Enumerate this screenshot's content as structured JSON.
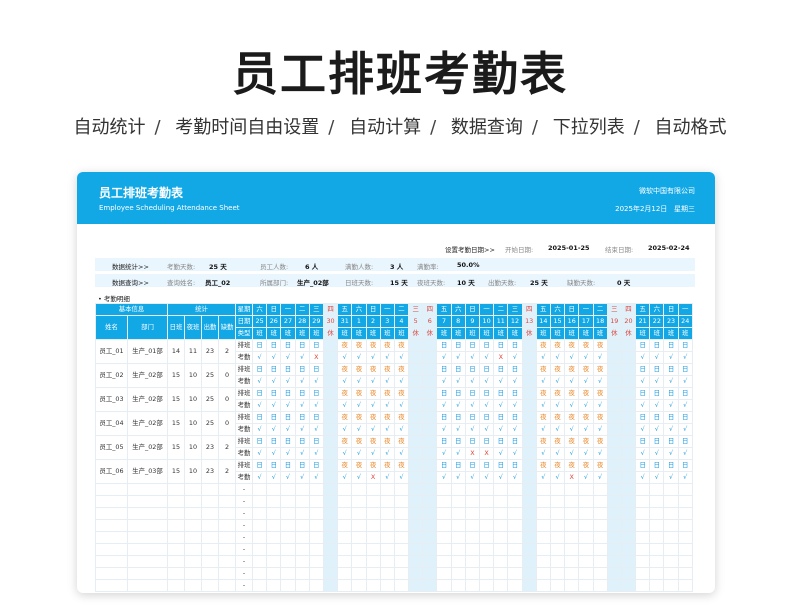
{
  "promo": {
    "title": "员工排班考勤表",
    "tags": [
      "自动统计",
      "考勤时间自由设置",
      "自动计算",
      "数据查询",
      "下拉列表",
      "自动格式"
    ]
  },
  "header": {
    "title": "员工排班考勤表",
    "subtitle": "Employee Scheduling Attendance Sheet",
    "company": "微软中国有限公司",
    "date": "2025年2月12日",
    "weekday": "星期三"
  },
  "settings": {
    "label": "设置考勤日期>>",
    "start_label": "开始日期:",
    "start_value": "2025-01-25",
    "end_label": "结束日期:",
    "end_value": "2025-02-24"
  },
  "stats": {
    "label": "数据统计>>",
    "days_label": "考勤天数:",
    "days_value": "25 天",
    "staff_label": "员工人数:",
    "staff_value": "6 人",
    "full_label": "满勤人数:",
    "full_value": "3 人",
    "rate_label": "满勤率:",
    "rate_value": "50.0%"
  },
  "query": {
    "label": "数据查询>>",
    "name_label": "查询姓名:",
    "name_value": "员工_02",
    "dept_label": "所属部门:",
    "dept_value": "生产_02部",
    "day_label": "日班天数:",
    "day_value": "15 天",
    "night_label": "夜班天数:",
    "night_value": "10 天",
    "attend_label": "出勤天数:",
    "attend_value": "25 天",
    "absent_label": "缺勤天数:",
    "absent_value": "0 天"
  },
  "detail_label": "• 考勤明细",
  "table": {
    "group_basic": "基本信息",
    "group_stats": "统计",
    "col_name": "姓名",
    "col_dept": "部门",
    "col_day": "日班",
    "col_night": "夜班",
    "col_attend": "出勤",
    "col_absent": "缺勤",
    "row_week": "星期",
    "row_date": "日期",
    "row_type": "类型",
    "row_shift": "排班",
    "row_check": "考勤",
    "weekdays": [
      "六",
      "日",
      "一",
      "二",
      "三",
      "四",
      "五",
      "六",
      "日",
      "一",
      "二",
      "三",
      "四",
      "五",
      "六",
      "日",
      "一",
      "二",
      "三",
      "四",
      "五",
      "六",
      "日",
      "一",
      "二",
      "三",
      "四",
      "五",
      "六",
      "日",
      "一"
    ],
    "dates": [
      "25",
      "26",
      "27",
      "28",
      "29",
      "30",
      "31",
      "1",
      "2",
      "3",
      "4",
      "5",
      "6",
      "7",
      "8",
      "9",
      "10",
      "11",
      "12",
      "13",
      "14",
      "15",
      "16",
      "17",
      "18",
      "19",
      "20",
      "21",
      "22",
      "23",
      "24"
    ],
    "types": [
      "班",
      "班",
      "班",
      "班",
      "班",
      "休",
      "班",
      "班",
      "班",
      "班",
      "班",
      "休",
      "休",
      "班",
      "班",
      "班",
      "班",
      "班",
      "班",
      "休",
      "班",
      "班",
      "班",
      "班",
      "班",
      "休",
      "休",
      "班",
      "班",
      "班",
      "班"
    ],
    "employees": [
      {
        "name": "员工_01",
        "dept": "生产_01部",
        "day": "14",
        "night": "11",
        "attend": "23",
        "absent": "2",
        "shift": [
          "日",
          "日",
          "日",
          "日",
          "日",
          "",
          "夜",
          "夜",
          "夜",
          "夜",
          "夜",
          "",
          "",
          "日",
          "日",
          "日",
          "日",
          "日",
          "日",
          "",
          "夜",
          "夜",
          "夜",
          "夜",
          "夜",
          "",
          "",
          "日",
          "日",
          "日",
          "日"
        ],
        "check": [
          "√",
          "√",
          "√",
          "√",
          "X",
          "",
          "√",
          "√",
          "√",
          "√",
          "√",
          "",
          "",
          "√",
          "√",
          "√",
          "√",
          "X",
          "√",
          "",
          "√",
          "√",
          "√",
          "√",
          "√",
          "",
          "",
          "√",
          "√",
          "√",
          "√"
        ]
      },
      {
        "name": "员工_02",
        "dept": "生产_02部",
        "day": "15",
        "night": "10",
        "attend": "25",
        "absent": "0",
        "shift": [
          "日",
          "日",
          "日",
          "日",
          "日",
          "",
          "夜",
          "夜",
          "夜",
          "夜",
          "夜",
          "",
          "",
          "日",
          "日",
          "日",
          "日",
          "日",
          "日",
          "",
          "夜",
          "夜",
          "夜",
          "夜",
          "夜",
          "",
          "",
          "日",
          "日",
          "日",
          "日"
        ],
        "check": [
          "√",
          "√",
          "√",
          "√",
          "√",
          "",
          "√",
          "√",
          "√",
          "√",
          "√",
          "",
          "",
          "√",
          "√",
          "√",
          "√",
          "√",
          "√",
          "",
          "√",
          "√",
          "√",
          "√",
          "√",
          "",
          "",
          "√",
          "√",
          "√",
          "√"
        ]
      },
      {
        "name": "员工_03",
        "dept": "生产_02部",
        "day": "15",
        "night": "10",
        "attend": "25",
        "absent": "0",
        "shift": [
          "日",
          "日",
          "日",
          "日",
          "日",
          "",
          "夜",
          "夜",
          "夜",
          "夜",
          "夜",
          "",
          "",
          "日",
          "日",
          "日",
          "日",
          "日",
          "日",
          "",
          "夜",
          "夜",
          "夜",
          "夜",
          "夜",
          "",
          "",
          "日",
          "日",
          "日",
          "日"
        ],
        "check": [
          "√",
          "√",
          "√",
          "√",
          "√",
          "",
          "√",
          "√",
          "√",
          "√",
          "√",
          "",
          "",
          "√",
          "√",
          "√",
          "√",
          "√",
          "√",
          "",
          "√",
          "√",
          "√",
          "√",
          "√",
          "",
          "",
          "√",
          "√",
          "√",
          "√"
        ]
      },
      {
        "name": "员工_04",
        "dept": "生产_02部",
        "day": "15",
        "night": "10",
        "attend": "25",
        "absent": "0",
        "shift": [
          "日",
          "日",
          "日",
          "日",
          "日",
          "",
          "夜",
          "夜",
          "夜",
          "夜",
          "夜",
          "",
          "",
          "日",
          "日",
          "日",
          "日",
          "日",
          "日",
          "",
          "夜",
          "夜",
          "夜",
          "夜",
          "夜",
          "",
          "",
          "日",
          "日",
          "日",
          "日"
        ],
        "check": [
          "√",
          "√",
          "√",
          "√",
          "√",
          "",
          "√",
          "√",
          "√",
          "√",
          "√",
          "",
          "",
          "√",
          "√",
          "√",
          "√",
          "√",
          "√",
          "",
          "√",
          "√",
          "√",
          "√",
          "√",
          "",
          "",
          "√",
          "√",
          "√",
          "√"
        ]
      },
      {
        "name": "员工_05",
        "dept": "生产_02部",
        "day": "15",
        "night": "10",
        "attend": "23",
        "absent": "2",
        "shift": [
          "日",
          "日",
          "日",
          "日",
          "日",
          "",
          "夜",
          "夜",
          "夜",
          "夜",
          "夜",
          "",
          "",
          "日",
          "日",
          "日",
          "日",
          "日",
          "日",
          "",
          "夜",
          "夜",
          "夜",
          "夜",
          "夜",
          "",
          "",
          "日",
          "日",
          "日",
          "日"
        ],
        "check": [
          "√",
          "√",
          "√",
          "√",
          "√",
          "",
          "√",
          "√",
          "√",
          "√",
          "√",
          "",
          "",
          "√",
          "√",
          "X",
          "X",
          "√",
          "√",
          "",
          "√",
          "√",
          "√",
          "√",
          "√",
          "",
          "",
          "√",
          "√",
          "√",
          "√"
        ]
      },
      {
        "name": "员工_06",
        "dept": "生产_03部",
        "day": "15",
        "night": "10",
        "attend": "23",
        "absent": "2",
        "shift": [
          "日",
          "日",
          "日",
          "日",
          "日",
          "",
          "夜",
          "夜",
          "夜",
          "夜",
          "夜",
          "",
          "",
          "日",
          "日",
          "日",
          "日",
          "日",
          "日",
          "",
          "夜",
          "夜",
          "夜",
          "夜",
          "夜",
          "",
          "",
          "日",
          "日",
          "日",
          "日"
        ],
        "check": [
          "√",
          "√",
          "√",
          "√",
          "√",
          "",
          "√",
          "√",
          "X",
          "√",
          "√",
          "",
          "",
          "√",
          "√",
          "√",
          "√",
          "√",
          "√",
          "",
          "√",
          "√",
          "X",
          "√",
          "√",
          "",
          "",
          "√",
          "√",
          "√",
          "√"
        ]
      }
    ],
    "empty_row_mark": "-",
    "empty_rows": 9
  }
}
